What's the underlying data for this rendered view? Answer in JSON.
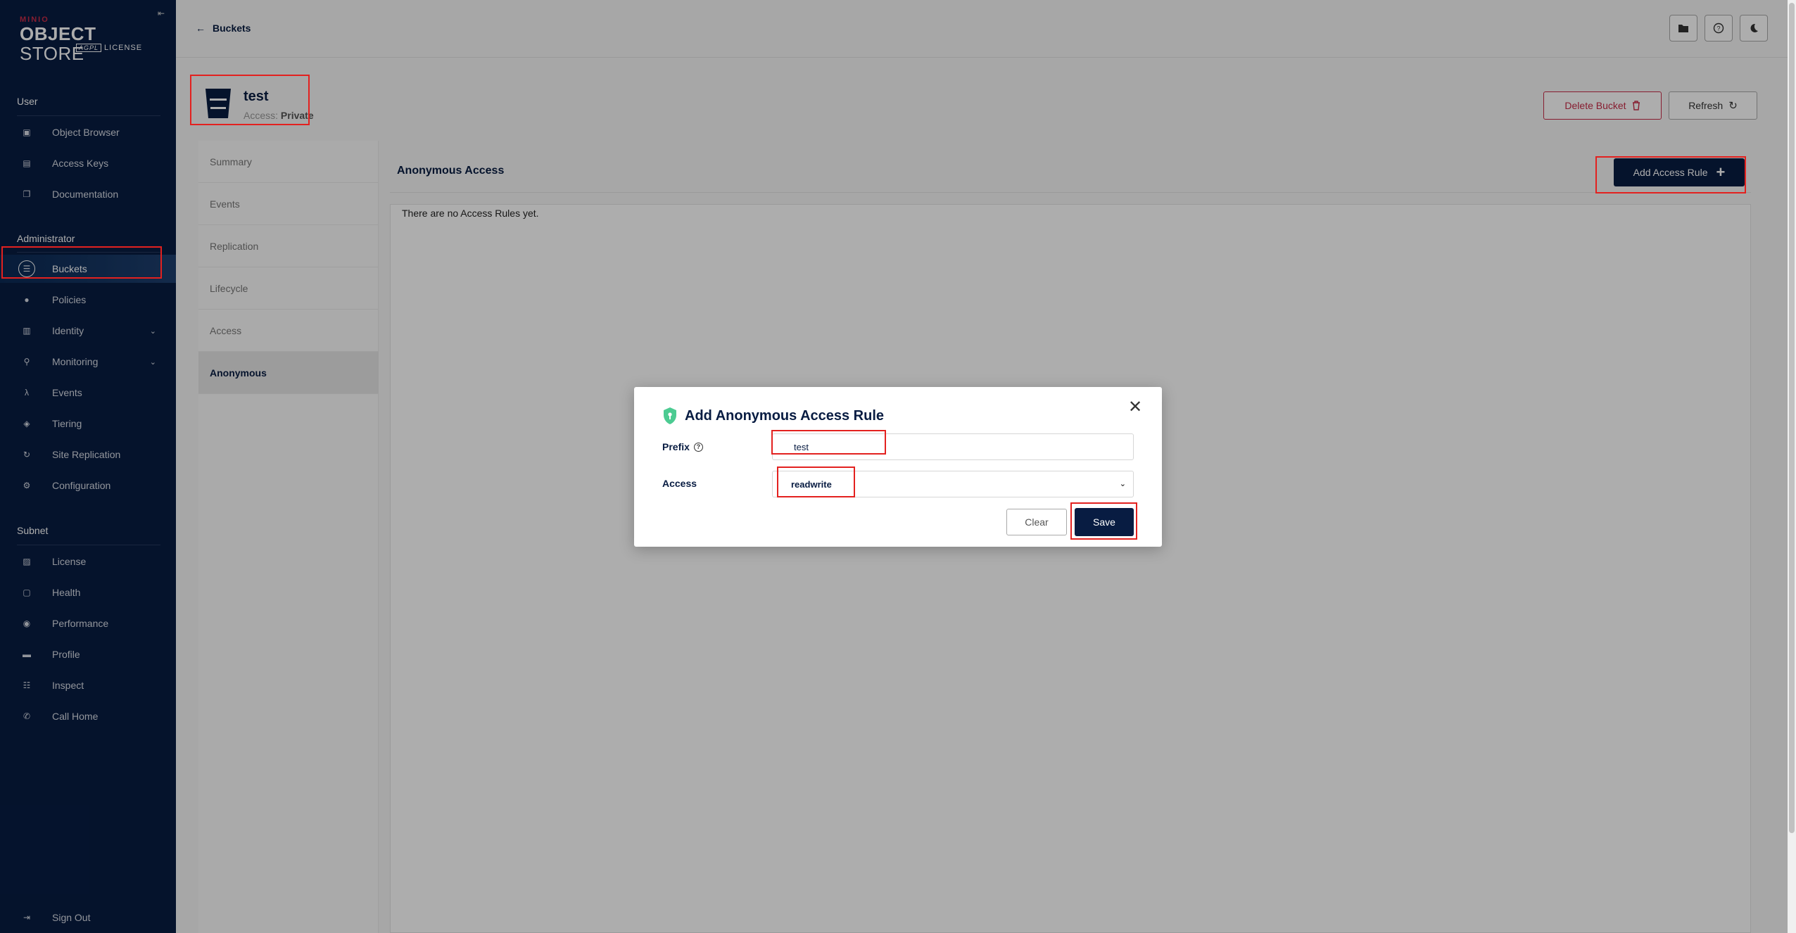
{
  "logo": {
    "brand_small": "MINIO",
    "brand_object": "OBJECT",
    "brand_store": " STORE",
    "brand_agpl": "AGPL",
    "brand_license": "LICENSE"
  },
  "sidebar": {
    "section_user": "User",
    "user_items": [
      {
        "label": "Object Browser",
        "icon": "object-browser-icon"
      },
      {
        "label": "Access Keys",
        "icon": "access-keys-icon"
      },
      {
        "label": "Documentation",
        "icon": "documentation-icon"
      }
    ],
    "section_admin": "Administrator",
    "admin_items": [
      {
        "label": "Buckets",
        "icon": "buckets-icon"
      },
      {
        "label": "Policies",
        "icon": "policies-icon"
      },
      {
        "label": "Identity",
        "icon": "identity-icon"
      },
      {
        "label": "Monitoring",
        "icon": "monitoring-icon"
      },
      {
        "label": "Events",
        "icon": "lambda-icon"
      },
      {
        "label": "Tiering",
        "icon": "tiering-icon"
      },
      {
        "label": "Site Replication",
        "icon": "replication-icon"
      },
      {
        "label": "Configuration",
        "icon": "gear-icon"
      }
    ],
    "section_subnet": "Subnet",
    "subnet_items": [
      {
        "label": "License",
        "icon": "license-icon"
      },
      {
        "label": "Health",
        "icon": "health-icon"
      },
      {
        "label": "Performance",
        "icon": "performance-icon"
      },
      {
        "label": "Profile",
        "icon": "profile-icon"
      },
      {
        "label": "Inspect",
        "icon": "inspect-icon"
      },
      {
        "label": "Call Home",
        "icon": "call-home-icon"
      }
    ],
    "sign_out": "Sign Out"
  },
  "topbar": {
    "back_label": "Buckets"
  },
  "bucket": {
    "name": "test",
    "access_label": "Access:",
    "access_value": "Private",
    "delete_label": "Delete Bucket",
    "refresh_label": "Refresh"
  },
  "tabs": [
    "Summary",
    "Events",
    "Replication",
    "Lifecycle",
    "Access",
    "Anonymous"
  ],
  "content": {
    "title": "Anonymous Access",
    "add_rule_label": "Add Access Rule",
    "empty_message": "There are no Access Rules yet."
  },
  "modal": {
    "title": "Add Anonymous Access Rule",
    "prefix_label": "Prefix",
    "prefix_value": "test",
    "access_label": "Access",
    "access_value": "readwrite",
    "clear_label": "Clear",
    "save_label": "Save"
  },
  "colors": {
    "sidebar_bg": "#081c42",
    "primary": "#081c42",
    "danger": "#c72c48",
    "annotation": "#e3211f",
    "shield": "#4ccb92"
  }
}
